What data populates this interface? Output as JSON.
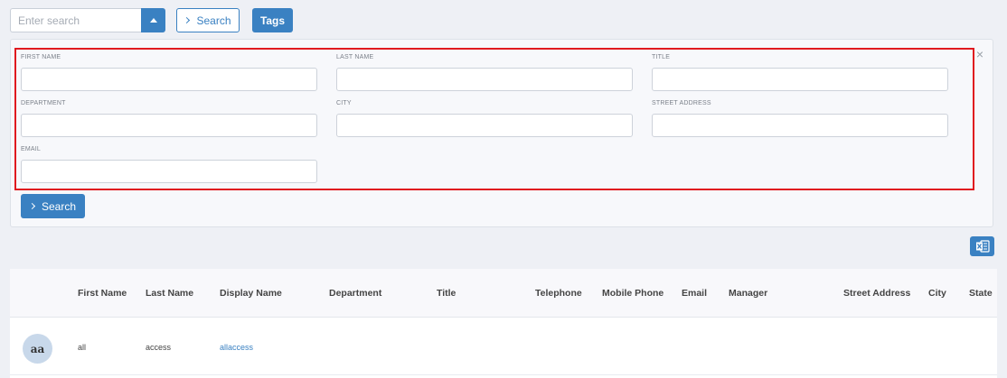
{
  "topbar": {
    "search_placeholder": "Enter search",
    "search_button": "Search",
    "tags_button": "Tags"
  },
  "advanced": {
    "fields": {
      "first_name": "FIRST NAME",
      "last_name": "LAST NAME",
      "title": "TITLE",
      "department": "DEPARTMENT",
      "city": "CITY",
      "street_address": "STREET ADDRESS",
      "email": "EMAIL"
    },
    "close_symbol": "×",
    "search_button": "Search"
  },
  "export": {
    "icon": "excel-icon"
  },
  "table": {
    "columns": [
      "First Name",
      "Last Name",
      "Display Name",
      "Department",
      "Title",
      "Telephone",
      "Mobile Phone",
      "Email",
      "Manager",
      "Street Address",
      "City",
      "State"
    ],
    "rows": [
      {
        "avatar": "aa",
        "first_name": "all",
        "last_name": "access",
        "display_name": "allaccess"
      }
    ]
  },
  "colors": {
    "accent": "#3a81c2",
    "highlight": "#e0191f",
    "background": "#eef0f5"
  }
}
